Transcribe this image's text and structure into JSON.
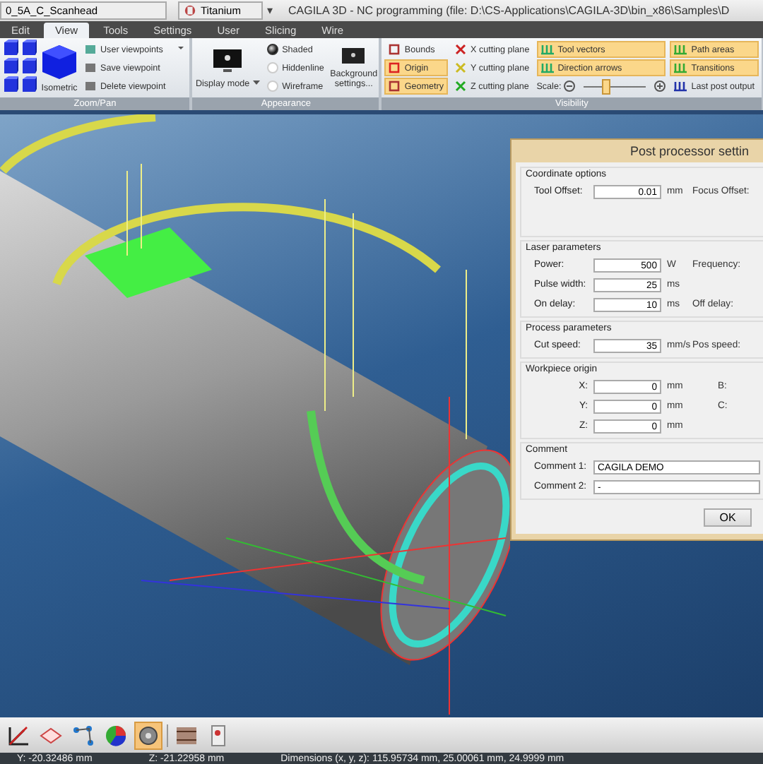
{
  "header": {
    "document": "0_5A_C_Scanhead",
    "material": "Titanium",
    "menu_arrow": "▾",
    "title": "CAGILA 3D - NC programming (file: D:\\CS-Applications\\CAGILA-3D\\bin_x86\\Samples\\D"
  },
  "tabs": [
    {
      "label": "Edit",
      "selected": false
    },
    {
      "label": "View",
      "selected": true
    },
    {
      "label": "Tools",
      "selected": false
    },
    {
      "label": "Settings",
      "selected": false
    },
    {
      "label": "User",
      "selected": false
    },
    {
      "label": "Slicing",
      "selected": false
    },
    {
      "label": "Wire",
      "selected": false
    }
  ],
  "ribbon": {
    "zoom_pan": {
      "label": "Zoom/Pan",
      "isometric": "Isometric"
    },
    "viewpoints": [
      "User viewpoints",
      "Save viewpoint",
      "Delete viewpoint"
    ],
    "appearance": {
      "label": "Appearance",
      "display_mode": "Display mode",
      "modes": [
        {
          "label": "Shaded",
          "selected": true
        },
        {
          "label": "Hiddenline",
          "selected": false
        },
        {
          "label": "Wireframe",
          "selected": false
        }
      ],
      "background": "Background settings..."
    },
    "visibility": {
      "label": "Visibility",
      "toggles": [
        {
          "label": "Bounds",
          "checked": false
        },
        {
          "label": "Origin",
          "checked": true
        },
        {
          "label": "Geometry",
          "checked": true
        }
      ],
      "planes": [
        "X cutting plane",
        "Y cutting plane",
        "Z cutting plane"
      ],
      "vectors": [
        {
          "label": "Tool vectors",
          "checked": true
        },
        {
          "label": "Direction arrows",
          "checked": true
        }
      ],
      "scale": {
        "label": "Scale:",
        "level": 0.35
      },
      "paths": [
        {
          "label": "Path areas",
          "checked": true
        },
        {
          "label": "Transitions",
          "checked": true
        },
        {
          "label": "Last post output",
          "checked": false
        }
      ]
    }
  },
  "dialog": {
    "title": "Post processor settin",
    "sections": [
      {
        "title": "Coordinate options",
        "kind": "param",
        "rows": [
          {
            "label": "Tool Offset:",
            "value": "0.01",
            "unit": "mm",
            "side_label": "Focus Offset:"
          }
        ]
      },
      {
        "title": "Laser parameters",
        "kind": "param",
        "rows": [
          {
            "label": "Power:",
            "value": "500",
            "unit": "W",
            "side_label": "Frequency:"
          },
          {
            "label": "Pulse width:",
            "value": "25",
            "unit": "ms"
          },
          {
            "label": "On delay:",
            "value": "10",
            "unit": "ms",
            "side_label": "Off delay:"
          }
        ]
      },
      {
        "title": "Process parameters",
        "kind": "param",
        "rows": [
          {
            "label": "Cut speed:",
            "value": "35",
            "unit": "mm/s",
            "side_label": "Pos speed:"
          }
        ]
      },
      {
        "title": "Workpiece origin",
        "kind": "axis",
        "rows": [
          {
            "label": "X:",
            "value": "0",
            "unit": "mm",
            "side_label": "B:"
          },
          {
            "label": "Y:",
            "value": "0",
            "unit": "mm",
            "side_label": "C:"
          },
          {
            "label": "Z:",
            "value": "0",
            "unit": "mm"
          }
        ]
      },
      {
        "title": "Comment",
        "kind": "comment",
        "rows": [
          {
            "label": "Comment 1:",
            "value": "CAGILA DEMO"
          },
          {
            "label": "Comment 2:",
            "value": "-"
          }
        ]
      }
    ],
    "buttons": [
      "OK"
    ]
  },
  "tools": [
    {
      "selected": false
    },
    {
      "selected": false
    },
    {
      "selected": false
    },
    {
      "selected": false
    },
    {
      "selected": true
    },
    {
      "selected": false
    },
    {
      "selected": false
    }
  ],
  "status_bar": [
    "Y: -20.32486 mm",
    "Z: -21.22958 mm",
    "Dimensions (x, y, z): 115.95734 mm, 25.00061 mm, 24.9999 mm"
  ]
}
